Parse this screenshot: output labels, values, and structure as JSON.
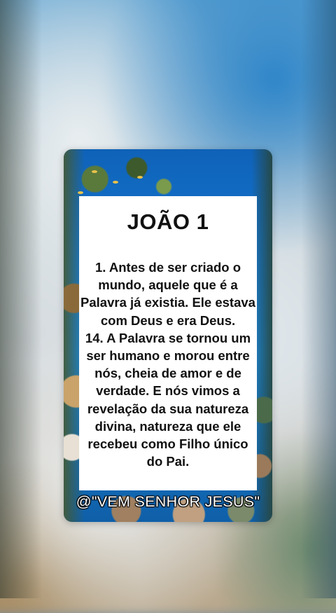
{
  "card": {
    "title": "JOÃO 1",
    "verses": [
      "1. Antes de ser criado o mundo, aquele que é a Palavra já existia. Ele estava com Deus e era Deus.",
      "14. A Palavra se tornou um ser humano e morou entre nós, cheia de amor e de verdade. E nós vimos a revelação da sua natureza divina, natureza que ele recebeu como Filho único do Pai."
    ],
    "watermark": "@\"VEM SENHOR JESUS\""
  },
  "colors": {
    "ocean_blue": "#1577d0",
    "panel_white": "#ffffff",
    "text": "#111111"
  }
}
